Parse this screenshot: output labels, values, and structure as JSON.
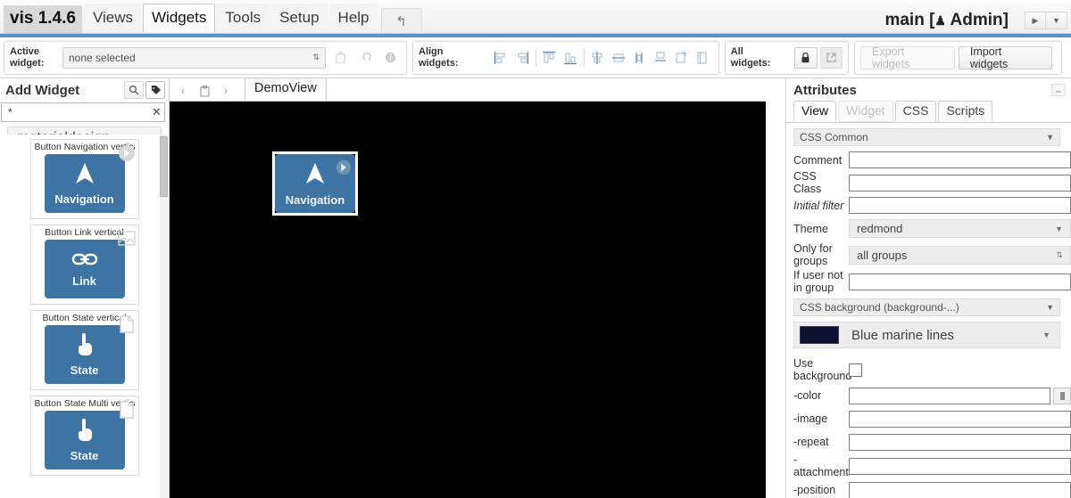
{
  "menubar": {
    "brand": "vis 1.4.6",
    "tabs": [
      {
        "label": "Views",
        "active": false
      },
      {
        "label": "Widgets",
        "active": true
      },
      {
        "label": "Tools",
        "active": false
      },
      {
        "label": "Setup",
        "active": false
      },
      {
        "label": "Help",
        "active": false
      }
    ],
    "undo_icon": "undo-icon",
    "project_title": "main [",
    "project_user": " Admin]",
    "user_icon": "person-icon",
    "play_icon": "play-icon",
    "dropdown_icon": "chevron-down-icon"
  },
  "toolbar": {
    "active_widget_label_line1": "Active",
    "active_widget_label_line2": "widget:",
    "active_widget_value": "none selected",
    "active_widget_buttons": [
      {
        "name": "delete-widget-button",
        "icon": "trash-icon",
        "disabled": true
      },
      {
        "name": "undo-widget-button",
        "icon": "undo-arrow-icon",
        "disabled": true
      },
      {
        "name": "widget-info-button",
        "icon": "info-icon",
        "disabled": true
      }
    ],
    "align_label": "Align widgets:",
    "align_buttons": [
      {
        "name": "align-left-button",
        "icon": "align-left-icon"
      },
      {
        "name": "align-right-button",
        "icon": "align-right-icon"
      },
      {
        "name": "align-top-button",
        "icon": "align-top-icon"
      },
      {
        "name": "align-bottom-button",
        "icon": "align-bottom-icon"
      },
      {
        "name": "align-horizontal-center-button",
        "icon": "align-h-center-icon"
      },
      {
        "name": "align-vertical-center-button",
        "icon": "align-v-center-icon"
      },
      {
        "name": "distribute-horizontal-button",
        "icon": "distribute-h-icon"
      },
      {
        "name": "distribute-vertical-button",
        "icon": "distribute-v-icon"
      },
      {
        "name": "equal-width-button",
        "icon": "equal-width-icon"
      },
      {
        "name": "equal-height-button",
        "icon": "equal-height-icon"
      }
    ],
    "all_widgets_label": "All widgets:",
    "lock_icon": "lock-icon",
    "expand_icon": "expand-icon",
    "export_label": "Export widgets",
    "import_label": "Import widgets"
  },
  "sidebar": {
    "title": "Add Widget",
    "header_icons": [
      {
        "name": "search-icon",
        "glyph": "search-icon",
        "active": false
      },
      {
        "name": "tag-icon",
        "glyph": "tag-icon",
        "active": true
      }
    ],
    "filter_value": "*",
    "filter_placeholder": "",
    "clear_icon": "close-icon",
    "group_name": "materialdesign",
    "group_caret": "chevron-down-icon",
    "widgets": [
      {
        "title": "Button Navigation vertical",
        "label": "Navigation",
        "glyph": "navigation-arrow-icon",
        "badge": "arrow-right-badge-icon"
      },
      {
        "title": "Button Link vertical",
        "label": "Link",
        "glyph": "link-icon",
        "badge": "image-badge-icon"
      },
      {
        "title": "Button State vertical",
        "label": "State",
        "glyph": "hand-pointer-icon",
        "badge": "page-badge-icon"
      },
      {
        "title": "Button State Multi vertical",
        "label": "State",
        "glyph": "hand-pointer-icon",
        "badge": "page-badge-icon"
      }
    ]
  },
  "canvas": {
    "nav_prev_icon": "chevron-left-icon",
    "nav_clipboard_icon": "clipboard-icon",
    "nav_next_icon": "chevron-right-icon",
    "view_tab": "DemoView",
    "background_color": "#000000",
    "placed_widget": {
      "label": "Navigation",
      "glyph": "navigation-arrow-icon",
      "badge": "arrow-right-badge-icon"
    }
  },
  "attributes": {
    "title": "Attributes",
    "minimize_icon": "minimize-icon",
    "tabs": [
      {
        "label": "View",
        "active": true,
        "disabled": false
      },
      {
        "label": "Widget",
        "active": false,
        "disabled": true
      },
      {
        "label": "CSS",
        "active": false,
        "disabled": false
      },
      {
        "label": "Scripts",
        "active": false,
        "disabled": false
      }
    ],
    "section_css_common": "CSS Common",
    "fields": {
      "comment_label": "Comment",
      "comment_value": "",
      "css_class_label": "CSS Class",
      "css_class_value": "",
      "initial_filter_label": "Initial filter",
      "initial_filter_value": "",
      "theme_label": "Theme",
      "theme_value": "redmond",
      "only_for_groups_label_line1": "Only for",
      "only_for_groups_label_line2": "groups",
      "only_for_groups_value": "all groups",
      "if_user_not_label_line1": "If user not",
      "if_user_not_label_line2": "in group",
      "if_user_not_value": ""
    },
    "section_css_background": "CSS background (background-...)",
    "background_preset": {
      "name": "Blue marine lines",
      "swatch_color": "#0d1030"
    },
    "use_background_label_line1": "Use",
    "use_background_label_line2": "background",
    "use_background_checked": false,
    "bg_fields": [
      {
        "label": "-color",
        "value": "",
        "has_color_picker": true
      },
      {
        "label": "-image",
        "value": "",
        "has_color_picker": false
      },
      {
        "label": "-repeat",
        "value": "",
        "has_color_picker": false
      },
      {
        "label": "-attachment",
        "value": "",
        "has_color_picker": false,
        "label_line1": "-",
        "label_line2": "attachment"
      },
      {
        "label": "-position",
        "value": "",
        "has_color_picker": false
      }
    ],
    "color_picker_icon": "color-picker-icon"
  }
}
